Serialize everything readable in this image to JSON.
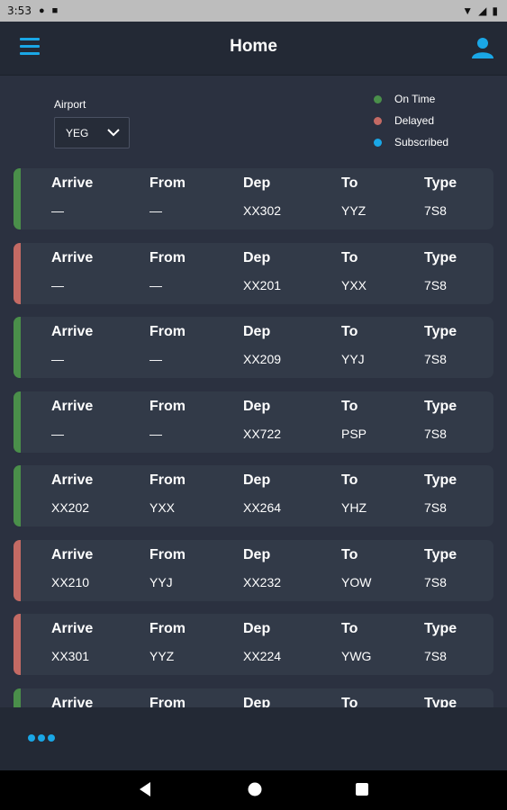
{
  "status_bar": {
    "time": "3:53"
  },
  "header": {
    "title": "Home"
  },
  "airport": {
    "label": "Airport",
    "selected": "YEG"
  },
  "legend": [
    {
      "label": "On Time",
      "color": "#4a8f4a"
    },
    {
      "label": "Delayed",
      "color": "#c46a64"
    },
    {
      "label": "Subscribed",
      "color": "#1aa7e6"
    }
  ],
  "columns": [
    "Arrive",
    "From",
    "Dep",
    "To",
    "Type"
  ],
  "flights": [
    {
      "status": "on-time",
      "arrive": "—",
      "from": "—",
      "dep": "XX302",
      "to": "YYZ",
      "type": "7S8"
    },
    {
      "status": "delayed",
      "arrive": "—",
      "from": "—",
      "dep": "XX201",
      "to": "YXX",
      "type": "7S8"
    },
    {
      "status": "on-time",
      "arrive": "—",
      "from": "—",
      "dep": "XX209",
      "to": "YYJ",
      "type": "7S8"
    },
    {
      "status": "on-time",
      "arrive": "—",
      "from": "—",
      "dep": "XX722",
      "to": "PSP",
      "type": "7S8"
    },
    {
      "status": "on-time",
      "arrive": "XX202",
      "from": "YXX",
      "dep": "XX264",
      "to": "YHZ",
      "type": "7S8"
    },
    {
      "status": "delayed",
      "arrive": "XX210",
      "from": "YYJ",
      "dep": "XX232",
      "to": "YOW",
      "type": "7S8"
    },
    {
      "status": "delayed",
      "arrive": "XX301",
      "from": "YYZ",
      "dep": "XX224",
      "to": "YWG",
      "type": "7S8"
    },
    {
      "status": "on-time",
      "arrive": "",
      "from": "",
      "dep": "",
      "to": "",
      "type": ""
    }
  ],
  "colors": {
    "accent": "#1aa7e6",
    "on_time": "#4a8f4a",
    "delayed": "#c46a64"
  },
  "icons": {
    "menu": "hamburger-icon",
    "user": "user-icon",
    "more": "more-dots-icon"
  }
}
